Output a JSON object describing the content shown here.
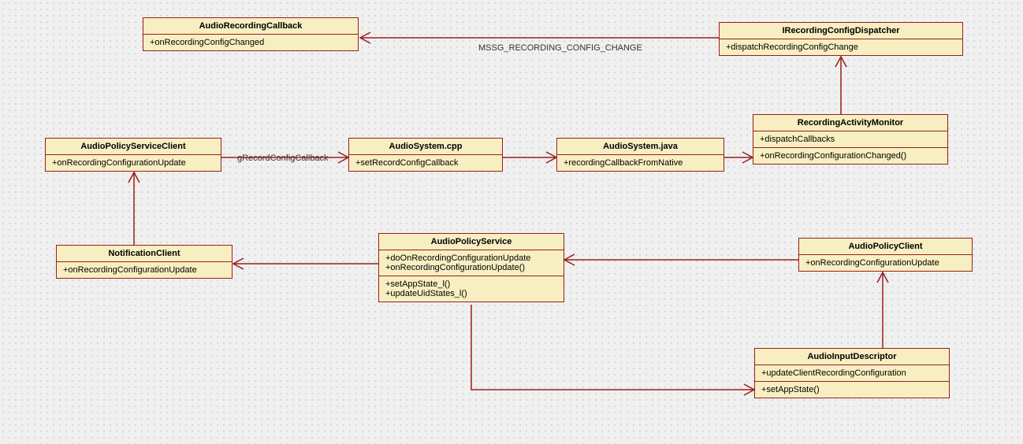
{
  "classes": {
    "audioRecordingCallback": {
      "name": "AudioRecordingCallback",
      "members": [
        "+onRecordingConfigChanged"
      ]
    },
    "iRecordingConfigDispatcher": {
      "name": "IRecordingConfigDispatcher",
      "members": [
        "+dispatchRecordingConfigChange"
      ]
    },
    "recordingActivityMonitor": {
      "name": "RecordingActivityMonitor",
      "members": [
        "+dispatchCallbacks",
        "+onRecordingConfigurationChanged()"
      ]
    },
    "audioPolicyServiceClient": {
      "name": "AudioPolicyServiceClient",
      "members": [
        "+onRecordingConfigurationUpdate"
      ]
    },
    "audioSystemCpp": {
      "name": "AudioSystem.cpp",
      "members": [
        "+setRecordConfigCallback"
      ]
    },
    "audioSystemJava": {
      "name": "AudioSystem.java",
      "members": [
        "+recordingCallbackFromNative"
      ]
    },
    "notificationClient": {
      "name": "NotificationClient",
      "members": [
        "+onRecordingConfigurationUpdate"
      ]
    },
    "audioPolicyService": {
      "name": "AudioPolicyService",
      "members1": [
        "+doOnRecordingConfigurationUpdate",
        "+onRecordingConfigurationUpdate()"
      ],
      "members2": [
        "+setAppState_l()",
        "+updateUidStates_l()"
      ]
    },
    "audioPolicyClient": {
      "name": "AudioPolicyClient",
      "members": [
        "+onRecordingConfigurationUpdate"
      ]
    },
    "audioInputDescriptor": {
      "name": "AudioInputDescriptor",
      "members1": [
        "+updateClientRecordingConfiguration"
      ],
      "members2": [
        "+setAppState()"
      ]
    }
  },
  "edgeLabels": {
    "msgRecordingConfigChange": "MSSG_RECORDING_CONFIG_CHANGE",
    "gRecordConfigCallback": "gRecordConfigCallback"
  }
}
